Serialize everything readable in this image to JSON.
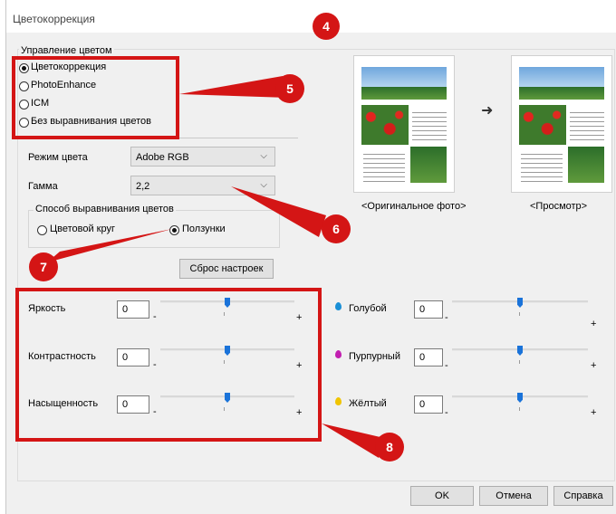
{
  "window": {
    "title": "Цветокоррекция"
  },
  "color_management": {
    "group_title": "Управление цветом",
    "options": [
      {
        "label": "Цветокоррекция",
        "selected": true
      },
      {
        "label": "PhotoEnhance",
        "selected": false
      },
      {
        "label": "ICM",
        "selected": false
      },
      {
        "label": "Без выравнивания цветов",
        "selected": false
      }
    ]
  },
  "color_mode": {
    "label": "Режим цвета",
    "value": "Adobe RGB"
  },
  "gamma": {
    "label": "Гамма",
    "value": "2,2"
  },
  "balance_method": {
    "group_title": "Способ выравнивания цветов",
    "options": [
      {
        "label": "Цветовой круг",
        "selected": false
      },
      {
        "label": "Ползунки",
        "selected": true
      }
    ]
  },
  "reset_button": "Сброс настроек",
  "preview": {
    "original_label": "<Оригинальное фото>",
    "preview_label": "<Просмотр>",
    "arrow": "➜"
  },
  "adjustments_left": [
    {
      "label": "Яркость",
      "value": "0",
      "level": 0.5
    },
    {
      "label": "Контрастность",
      "value": "0",
      "level": 0.5
    },
    {
      "label": "Насыщенность",
      "value": "0",
      "level": 0.5
    }
  ],
  "adjustments_right": [
    {
      "label": "Голубой",
      "value": "0",
      "level": 0.5,
      "icon": "cyan-drop-icon",
      "color": "#1a8fd6"
    },
    {
      "label": "Пурпурный",
      "value": "0",
      "level": 0.5,
      "icon": "magenta-drop-icon",
      "color": "#c21fb0"
    },
    {
      "label": "Жёлтый",
      "value": "0",
      "level": 0.5,
      "icon": "yellow-drop-icon",
      "color": "#f0c400"
    }
  ],
  "slider_signs": {
    "minus": "-",
    "plus": "+"
  },
  "buttons": {
    "ok": "OK",
    "cancel": "Отмена",
    "help": "Справка"
  },
  "callouts": [
    "4",
    "5",
    "6",
    "7",
    "8"
  ],
  "colors": {
    "callout_red": "#d41515",
    "slider_thumb": "#1a73d9"
  }
}
